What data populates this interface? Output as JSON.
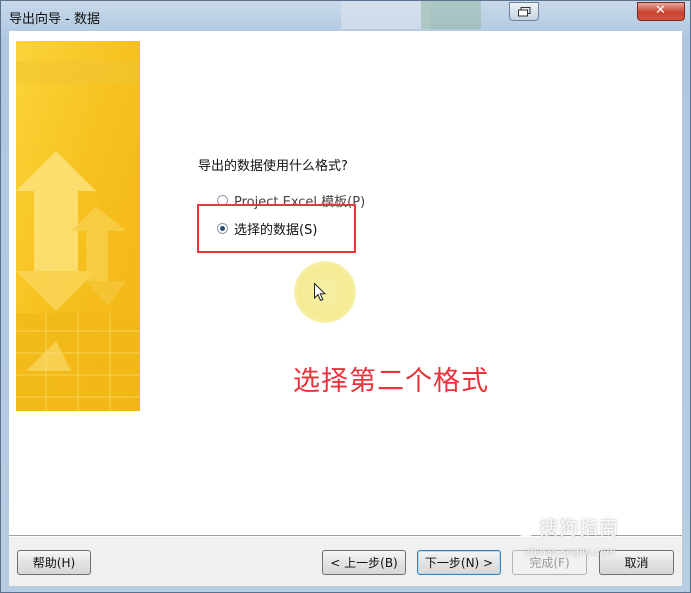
{
  "window": {
    "title": "导出向导 - 数据",
    "close_glyph": "✕"
  },
  "wizard": {
    "question": "导出的数据使用什么格式?",
    "options": [
      {
        "label": "Project Excel 模板(P)",
        "checked": false
      },
      {
        "label": "选择的数据(S)",
        "checked": true
      }
    ]
  },
  "annotation": {
    "text": "选择第二个格式"
  },
  "buttons": {
    "help": "帮助(H)",
    "back": "< 上一步(B)",
    "next": "下一步(N) >",
    "finish": "完成(F)",
    "cancel": "取消"
  },
  "watermark": {
    "logo_letter": "S",
    "text": "搜狗指南",
    "url": "zhinan.sogou.com"
  },
  "colors": {
    "annotation_red": "#e8343a",
    "banner_yellow": "#f8c21a"
  },
  "icons": {
    "restore": "restore-icon",
    "close": "close-icon",
    "cursor": "mouse-cursor-icon"
  }
}
